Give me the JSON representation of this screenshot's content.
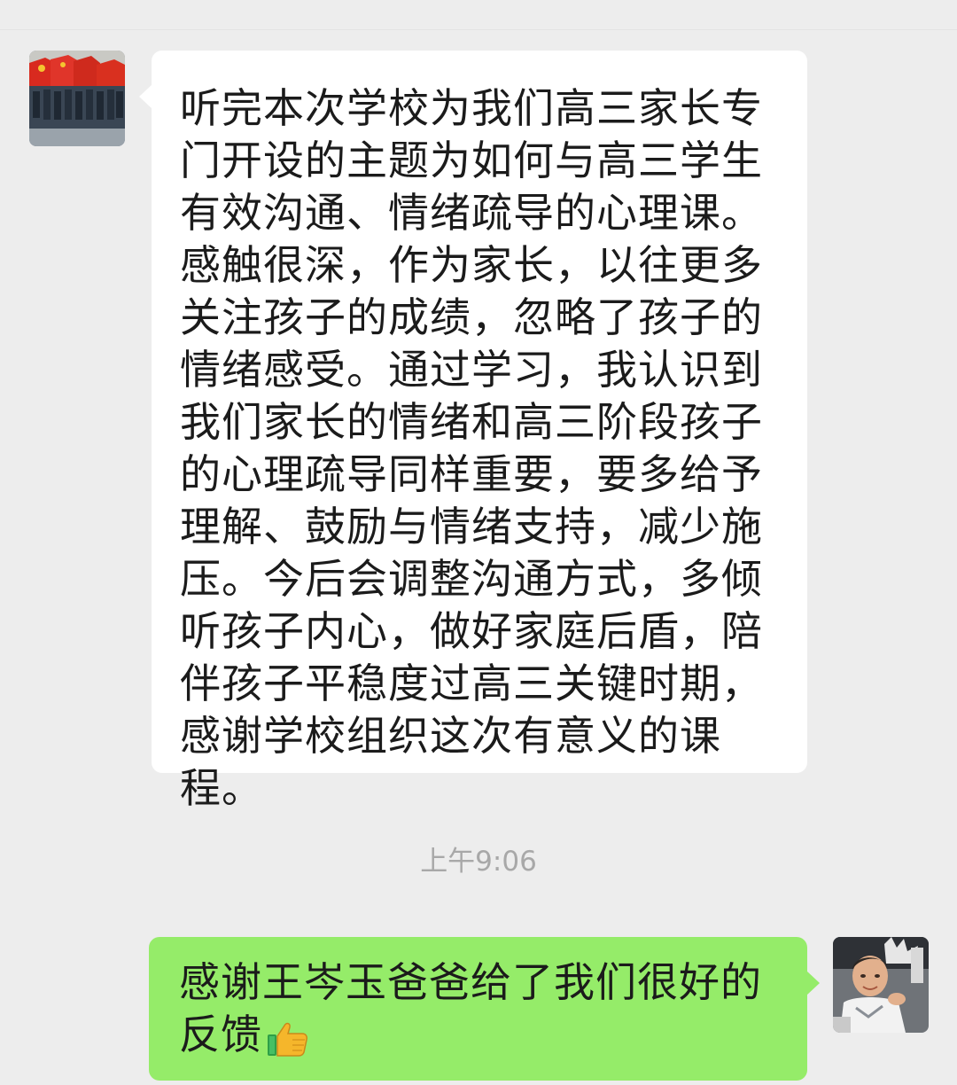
{
  "conversation": {
    "messages": [
      {
        "direction": "incoming",
        "text": "听完本次学校为我们高三家长专门开设的主题为如何与高三学生有效沟通、情绪疏导的心理课。感触很深，作为家长，以往更多关注孩子的成绩，忽略了孩子的情绪感受。通过学习，我认识到我们家长的情绪和高三阶段孩子的心理疏导同样重要，要多给予理解、鼓励与情绪支持，减少施压。今后会调整沟通方式，多倾听孩子内心，做好家庭后盾，陪伴孩子平稳度过高三关键时期，感谢学校组织这次有意义的课程。"
      },
      {
        "direction": "outgoing",
        "text": "感谢王岑玉爸爸给了我们很好的反馈",
        "emoji": "thumbs-up-icon"
      }
    ],
    "timestamp": "上午9:06"
  },
  "colors": {
    "background": "#ededed",
    "incoming_bubble": "#ffffff",
    "outgoing_bubble": "#95ec69",
    "timestamp_text": "#a8a8a8"
  }
}
